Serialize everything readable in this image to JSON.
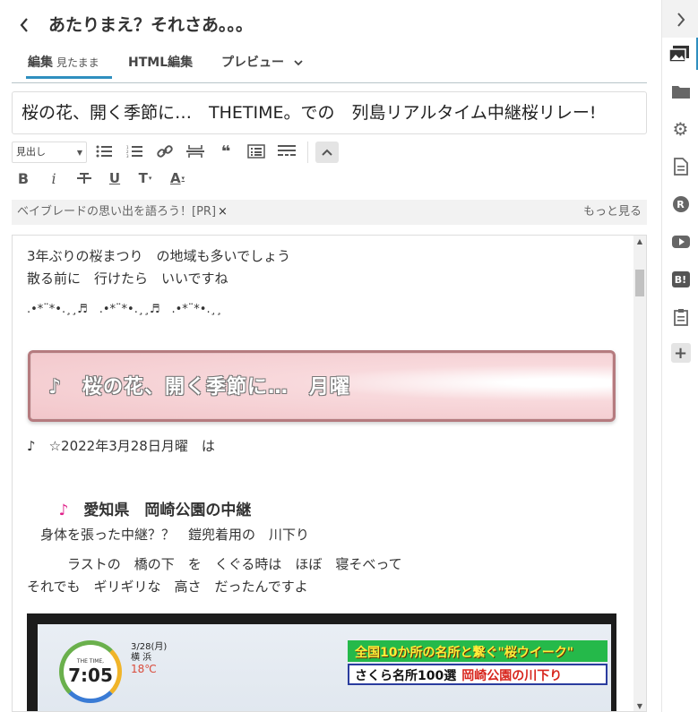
{
  "header": {
    "back_icon": "chevron-left-icon",
    "title": "あたりまえ？それさあ。。。"
  },
  "tabs": [
    {
      "label": "編集",
      "sub": "見たまま",
      "active": true
    },
    {
      "label": "HTML編集",
      "active": false
    },
    {
      "label": "プレビュー",
      "active": false
    }
  ],
  "title_field": {
    "value": "桜の花、開く季節に…　THETIME。での　列島リアルタイム中継桜リレー!"
  },
  "toolbar": {
    "heading_select": "見出し",
    "row1_icons": [
      "bullet-list-icon",
      "numbered-list-icon",
      "link-icon",
      "horizontal-rule-icon",
      "quote-icon",
      "table-of-contents-icon",
      "read-more-icon",
      "collapse-icon"
    ],
    "row2_icons": [
      "bold-icon",
      "italic-icon",
      "strikethrough-icon",
      "underline-icon",
      "font-size-icon",
      "font-color-icon"
    ],
    "bold": "B",
    "italic": "i",
    "strike": "∓",
    "underline": "U",
    "font_size": "T",
    "font_color": "A"
  },
  "pr_bar": {
    "text": "ベイブレードの思い出を語ろう！[PR]",
    "close": "×",
    "more": "もっと見る"
  },
  "editor": {
    "line1": "3年ぶりの桜まつり　の地域も多いでしょう",
    "line2": "散る前に　行けたら　いいですね",
    "line3": ".•*¨*•.¸¸♬　.•*¨*•.¸¸♬　.•*¨*•.¸¸",
    "banner_text": "♪　桜の花、開く季節に…　月曜",
    "line4": "♪　☆2022年3月28日月曜　は",
    "heading_note": "♪",
    "heading_text": "愛知県　岡崎公園の中継",
    "line5": "　身体を張った中継？？　鎧兜着用の　川下り",
    "line6": "　　　ラストの　橋の下　を　くぐる時は　ほぼ　寝そべって",
    "line7": "それでも　ギリギリな　高さ　だったんですよ",
    "photo": {
      "clock_brand": "THE TIME,",
      "clock_time": "7:05",
      "date": "3/28(月)",
      "city": "横 浜",
      "temp": "18℃",
      "telop1": "全国10か所の名所と繋ぐ\"桜ウイーク\"",
      "telop2_left": "さくら名所100選",
      "telop2_right": "岡崎公園の川下り"
    }
  },
  "sidebar": {
    "icons": [
      "chevron-right-icon",
      "image-icon",
      "folder-icon",
      "gear-icon",
      "document-icon",
      "r-badge-icon",
      "youtube-icon",
      "hatena-bookmark-icon",
      "clipboard-icon",
      "plus-icon"
    ],
    "r_label": "R",
    "b_label": "B!",
    "plus_label": "+"
  },
  "colors": {
    "accent": "#2f8fbf",
    "banner_border": "#b57b7f",
    "pink_note": "#e0218a"
  }
}
